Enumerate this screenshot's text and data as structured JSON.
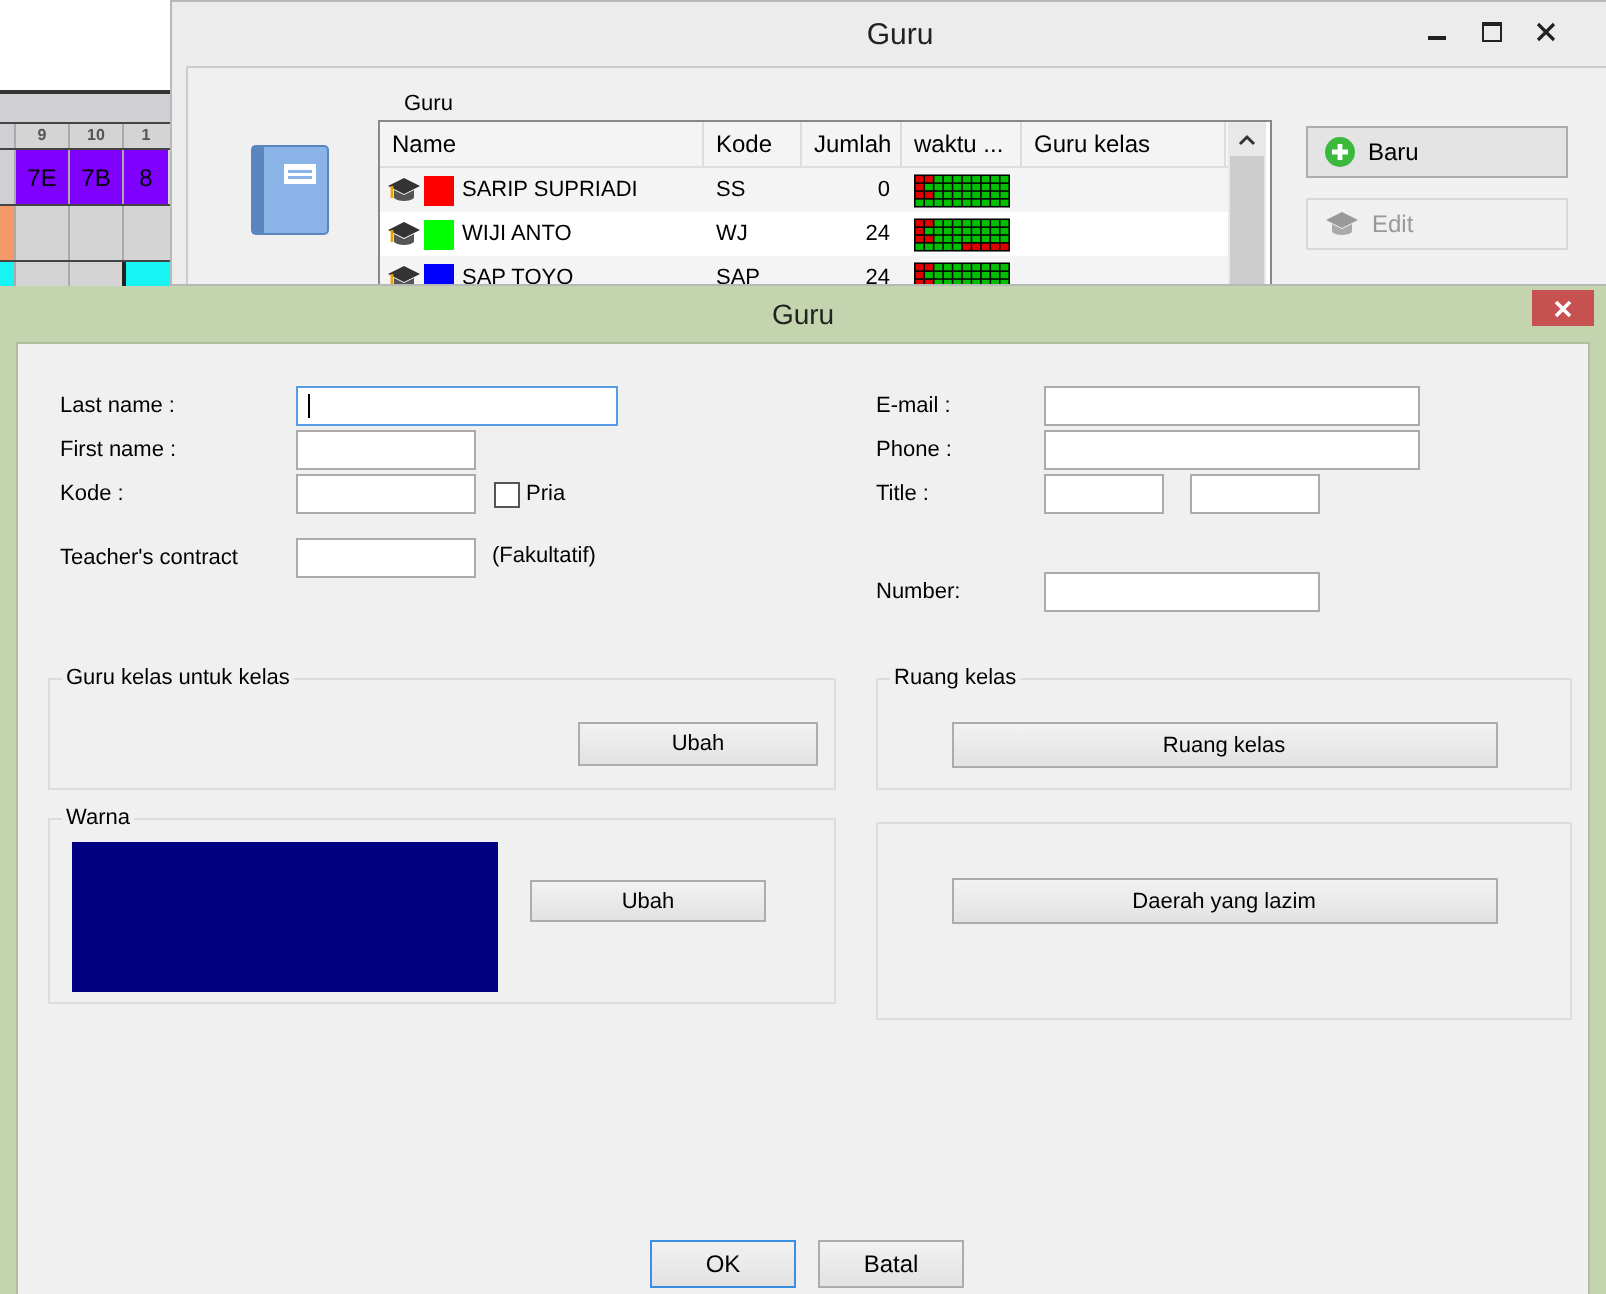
{
  "timetable": {
    "period_headers": [
      "9",
      "10",
      "1"
    ],
    "lessons": [
      {
        "text": "7E",
        "color": "#8000ff"
      },
      {
        "text": "7B",
        "color": "#8000ff"
      },
      {
        "text": "8",
        "color": "#8000ff"
      }
    ]
  },
  "list_window": {
    "title": "Guru",
    "list_label": "Guru",
    "columns": [
      "Name",
      "Kode",
      "Jumlah",
      "waktu ...",
      "Guru kelas"
    ],
    "rows": [
      {
        "name": "SARIP SUPRIADI",
        "code": "SS",
        "count": "0",
        "color": "#ff0000"
      },
      {
        "name": "WIJI ANTO",
        "code": "WJ",
        "count": "24",
        "color": "#00ff00"
      },
      {
        "name": "SAP TOYO",
        "code": "SAP",
        "count": "24",
        "color": "#0000ff"
      }
    ],
    "buttons": [
      {
        "label": "Baru",
        "kind": "add",
        "disabled": false
      },
      {
        "label": "Edit",
        "kind": "edit",
        "disabled": true
      }
    ]
  },
  "dialog": {
    "title": "Guru",
    "left_fields": [
      {
        "label": "Last name :",
        "kind": "long",
        "focused": true
      },
      {
        "label": "First name :",
        "kind": "short",
        "focused": false
      },
      {
        "label": "Kode :",
        "kind": "short",
        "focused": false,
        "checkbox": {
          "label": "Pria",
          "checked": false
        }
      },
      {
        "label": "Teacher's contract",
        "kind": "short",
        "focused": false,
        "note": "(Fakultatif)"
      }
    ],
    "right_fields": [
      {
        "label": "E-mail :",
        "kind": "long"
      },
      {
        "label": "Phone :",
        "kind": "long"
      },
      {
        "label": "Title :",
        "kind": "pair"
      },
      {
        "label": "Number:",
        "kind": "medium"
      }
    ],
    "groups": [
      {
        "title": "Guru kelas untuk kelas",
        "kind": "right_button",
        "button": "Ubah"
      },
      {
        "title": "Ruang kelas",
        "kind": "wide_button",
        "button": "Ruang kelas"
      },
      {
        "title": "Warna",
        "kind": "color",
        "button": "Ubah",
        "color": "#000080"
      },
      {
        "kind": "wide_button",
        "button": "Daerah yang lazim"
      }
    ],
    "buttons": [
      {
        "label": "OK",
        "default": true
      },
      {
        "label": "Batal",
        "default": false
      }
    ]
  }
}
